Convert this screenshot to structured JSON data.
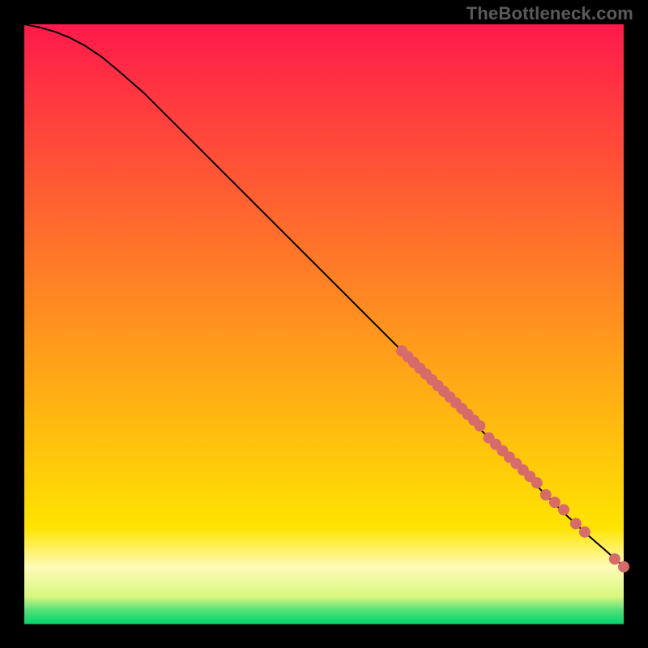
{
  "watermark": "TheBottleneck.com",
  "plot": {
    "inner_x": 30,
    "inner_y": 30,
    "inner_size": 740
  },
  "gradient_bands": [
    {
      "y0": 0.0,
      "y1": 0.84,
      "from": "#ff1a4b",
      "to": "#ffe400"
    },
    {
      "y0": 0.84,
      "y1": 0.905,
      "from": "#ffe400",
      "to": "#fffbb8"
    },
    {
      "y0": 0.905,
      "y1": 0.955,
      "from": "#fffbb8",
      "to": "#d7f77e"
    },
    {
      "y0": 0.955,
      "y1": 0.975,
      "from": "#d7f77e",
      "to": "#5ee27a"
    },
    {
      "y0": 0.975,
      "y1": 1.0,
      "from": "#5ee27a",
      "to": "#00d46b"
    }
  ],
  "curve_points": [
    {
      "x": 0.0,
      "y": 0.0
    },
    {
      "x": 0.025,
      "y": 0.005
    },
    {
      "x": 0.05,
      "y": 0.012
    },
    {
      "x": 0.075,
      "y": 0.022
    },
    {
      "x": 0.1,
      "y": 0.035
    },
    {
      "x": 0.13,
      "y": 0.055
    },
    {
      "x": 0.16,
      "y": 0.08
    },
    {
      "x": 0.2,
      "y": 0.115
    },
    {
      "x": 0.25,
      "y": 0.165
    },
    {
      "x": 0.3,
      "y": 0.215
    },
    {
      "x": 0.35,
      "y": 0.265
    },
    {
      "x": 0.4,
      "y": 0.315
    },
    {
      "x": 0.45,
      "y": 0.365
    },
    {
      "x": 0.5,
      "y": 0.415
    },
    {
      "x": 0.55,
      "y": 0.465
    },
    {
      "x": 0.6,
      "y": 0.515
    },
    {
      "x": 0.65,
      "y": 0.565
    },
    {
      "x": 0.7,
      "y": 0.615
    },
    {
      "x": 0.75,
      "y": 0.665
    },
    {
      "x": 0.8,
      "y": 0.715
    },
    {
      "x": 0.85,
      "y": 0.765
    },
    {
      "x": 0.9,
      "y": 0.815
    },
    {
      "x": 0.94,
      "y": 0.852
    },
    {
      "x": 0.97,
      "y": 0.878
    },
    {
      "x": 1.0,
      "y": 0.905
    }
  ],
  "markers": {
    "color": "#d76a6a",
    "radius": 7,
    "clusters": [
      {
        "start_x": 0.63,
        "start_y": 0.545,
        "end_x": 0.76,
        "end_y": 0.67,
        "count": 14
      },
      {
        "start_x": 0.775,
        "start_y": 0.69,
        "end_x": 0.855,
        "end_y": 0.765,
        "count": 8
      },
      {
        "start_x": 0.87,
        "start_y": 0.785,
        "end_x": 0.9,
        "end_y": 0.81,
        "count": 3
      },
      {
        "start_x": 0.92,
        "start_y": 0.833,
        "end_x": 0.935,
        "end_y": 0.847,
        "count": 2
      },
      {
        "start_x": 0.985,
        "start_y": 0.892,
        "end_x": 1.0,
        "end_y": 0.905,
        "count": 2
      }
    ]
  },
  "chart_data": {
    "type": "line",
    "title": "",
    "xlabel": "",
    "ylabel": "",
    "xlim": [
      0,
      1
    ],
    "ylim": [
      0,
      1
    ],
    "note": "Axes are unlabeled in the source image; coordinates are normalized to the plot's inner box.",
    "series": [
      {
        "name": "curve",
        "style": "line",
        "x": [
          0.0,
          0.025,
          0.05,
          0.075,
          0.1,
          0.13,
          0.16,
          0.2,
          0.25,
          0.3,
          0.35,
          0.4,
          0.45,
          0.5,
          0.55,
          0.6,
          0.65,
          0.7,
          0.75,
          0.8,
          0.85,
          0.9,
          0.94,
          0.97,
          1.0
        ],
        "y": [
          1.0,
          0.995,
          0.988,
          0.978,
          0.965,
          0.945,
          0.92,
          0.885,
          0.835,
          0.785,
          0.735,
          0.685,
          0.635,
          0.585,
          0.535,
          0.485,
          0.435,
          0.385,
          0.335,
          0.285,
          0.235,
          0.185,
          0.148,
          0.122,
          0.095
        ]
      },
      {
        "name": "markers",
        "style": "scatter",
        "x": [
          0.63,
          0.64,
          0.65,
          0.66,
          0.67,
          0.68,
          0.69,
          0.7,
          0.71,
          0.72,
          0.73,
          0.74,
          0.75,
          0.76,
          0.775,
          0.786,
          0.798,
          0.809,
          0.821,
          0.832,
          0.844,
          0.855,
          0.87,
          0.885,
          0.9,
          0.92,
          0.935,
          0.985,
          1.0
        ],
        "y": [
          0.455,
          0.445,
          0.436,
          0.426,
          0.416,
          0.407,
          0.397,
          0.388,
          0.378,
          0.368,
          0.359,
          0.349,
          0.34,
          0.33,
          0.31,
          0.299,
          0.289,
          0.278,
          0.267,
          0.257,
          0.246,
          0.235,
          0.215,
          0.202,
          0.19,
          0.167,
          0.153,
          0.108,
          0.095
        ]
      }
    ]
  }
}
